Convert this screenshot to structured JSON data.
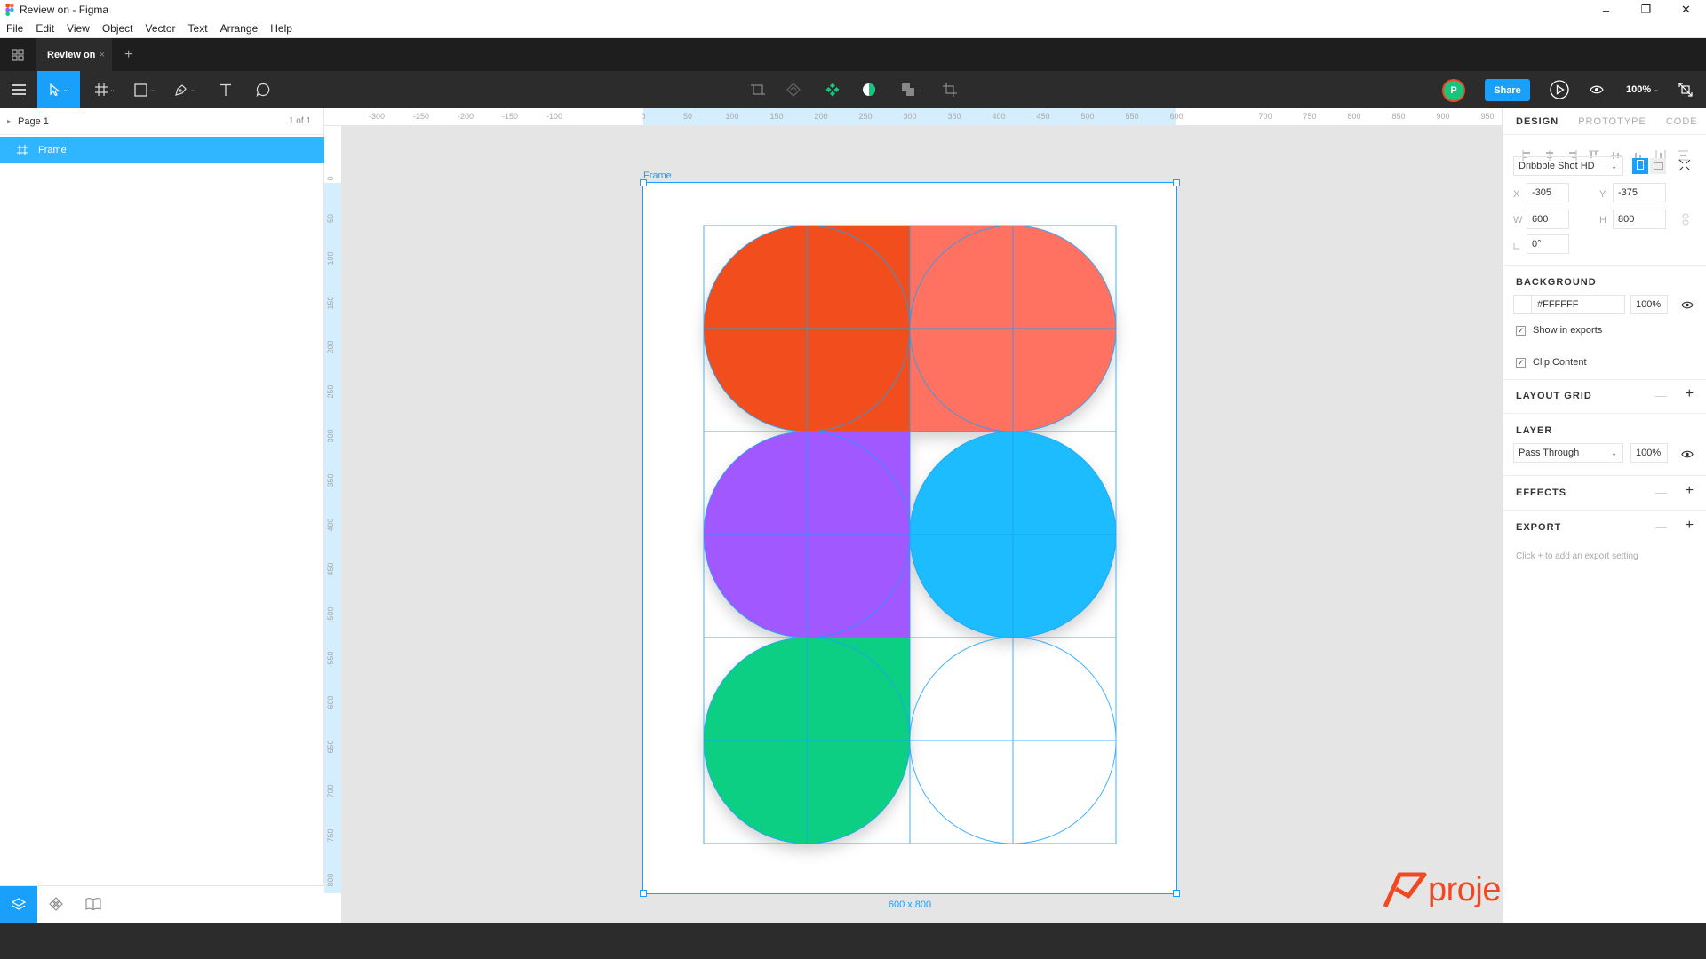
{
  "window": {
    "title": "Review on - Figma",
    "controls": [
      "–",
      "❐",
      "✕"
    ]
  },
  "menu": [
    "File",
    "Edit",
    "View",
    "Object",
    "Vector",
    "Text",
    "Arrange",
    "Help"
  ],
  "tabs": {
    "active": "Review on",
    "close": "×",
    "add": "+"
  },
  "toolbar": {
    "avatar_initial": "P",
    "share_label": "Share",
    "zoom": "100%",
    "caret": "⌄"
  },
  "layers": {
    "page_name": "Page 1",
    "page_count": "1 of 1",
    "items": [
      {
        "name": "Frame"
      }
    ]
  },
  "rulers": {
    "top": [
      "-300",
      "-250",
      "-200",
      "-150",
      "-100",
      "0",
      "50",
      "100",
      "150",
      "200",
      "250",
      "300",
      "350",
      "400",
      "450",
      "500",
      "550",
      "600",
      "700",
      "750",
      "800",
      "850",
      "900",
      "950"
    ],
    "left": [
      "0",
      "50",
      "100",
      "150",
      "200",
      "250",
      "300",
      "350",
      "400",
      "450",
      "500",
      "550",
      "600",
      "650",
      "700",
      "750",
      "800"
    ]
  },
  "canvas": {
    "frame_label": "Frame",
    "frame_size": "600 x 800",
    "colors": [
      "#f24e1e",
      "#ff7262",
      "#a259ff",
      "#1abcfe",
      "#0acf83",
      "#ffffff"
    ],
    "selection_color": "#18a0fb"
  },
  "watermark": {
    "text": "projectassistant",
    "color": "#f24822"
  },
  "help": "?",
  "design": {
    "tabs": [
      "DESIGN",
      "PROTOTYPE",
      "CODE"
    ],
    "preset": "Dribbble Shot HD",
    "x_label": "X",
    "x": "-305",
    "y_label": "Y",
    "y": "-375",
    "w_label": "W",
    "w": "600",
    "h_label": "H",
    "h": "800",
    "rotation": "0°",
    "background": {
      "title": "BACKGROUND",
      "color": "#FFFFFF",
      "opacity": "100%",
      "show_in_exports": "Show in exports",
      "clip_content": "Clip Content"
    },
    "layout_grid": "LAYOUT GRID",
    "layer": {
      "title": "LAYER",
      "blend": "Pass Through",
      "opacity": "100%"
    },
    "effects": "EFFECTS",
    "export": {
      "title": "EXPORT",
      "hint": "Click + to add an export setting"
    }
  }
}
